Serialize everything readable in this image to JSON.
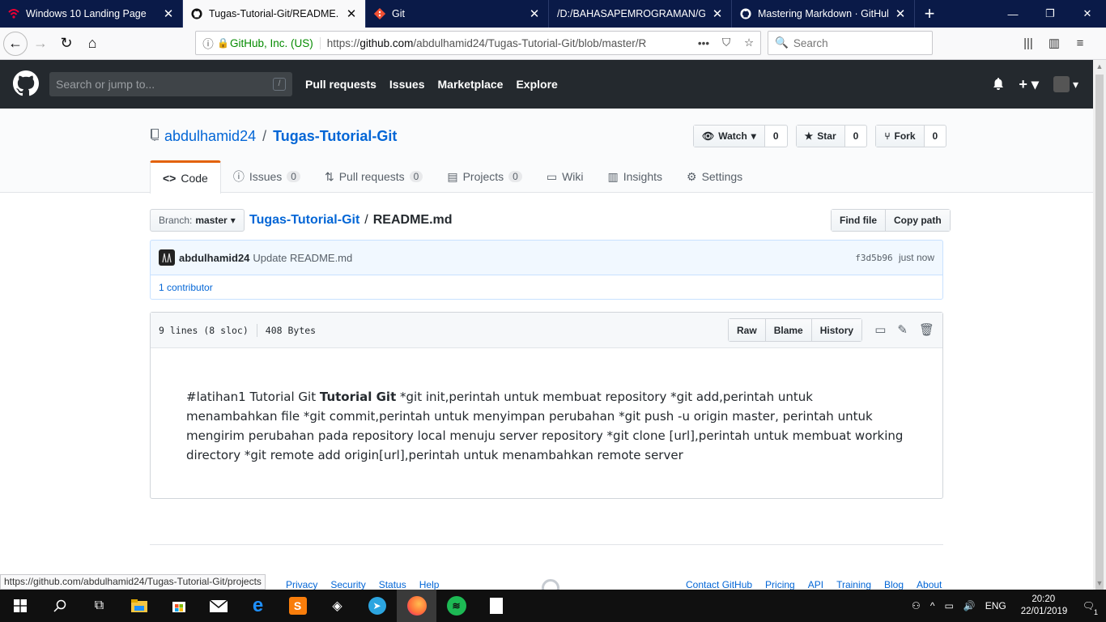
{
  "browser": {
    "tabs": [
      {
        "title": "Windows 10 Landing Page",
        "icon": "wifi-icon",
        "active": false
      },
      {
        "title": "Tugas-Tutorial-Git/README.m",
        "icon": "github-icon",
        "active": true
      },
      {
        "title": "Git",
        "icon": "git-icon",
        "active": false
      },
      {
        "title": "/D:/BAHASAPEMROGRAMAN/Git/",
        "icon": "",
        "active": false
      },
      {
        "title": "Mastering Markdown · GitHub",
        "icon": "github-icon",
        "active": false
      }
    ],
    "identity": "GitHub, Inc. (US)",
    "url_prefix": "https://",
    "url_host": "github.com",
    "url_path": "/abdulhamid24/Tugas-Tutorial-Git/blob/master/R",
    "search_placeholder": "Search"
  },
  "gh": {
    "search_placeholder": "Search or jump to...",
    "search_key": "/",
    "nav": [
      "Pull requests",
      "Issues",
      "Marketplace",
      "Explore"
    ]
  },
  "repo": {
    "owner": "abdulhamid24",
    "separator": "/",
    "name": "Tugas-Tutorial-Git",
    "watch_label": "Watch",
    "watch_count": "0",
    "star_label": "Star",
    "star_count": "0",
    "fork_label": "Fork",
    "fork_count": "0",
    "tabs": [
      {
        "label": "Code",
        "count": "",
        "icon": "code-icon"
      },
      {
        "label": "Issues",
        "count": "0",
        "icon": "issue-icon"
      },
      {
        "label": "Pull requests",
        "count": "0",
        "icon": "pull-request-icon"
      },
      {
        "label": "Projects",
        "count": "0",
        "icon": "project-icon"
      },
      {
        "label": "Wiki",
        "count": "",
        "icon": "book-icon"
      },
      {
        "label": "Insights",
        "count": "",
        "icon": "graph-icon"
      },
      {
        "label": "Settings",
        "count": "",
        "icon": "gear-icon"
      }
    ]
  },
  "file": {
    "branch_label": "Branch:",
    "branch": "master",
    "crumb_repo": "Tugas-Tutorial-Git",
    "crumb_sep": "/",
    "filename": "README.md",
    "find_file": "Find file",
    "copy_path": "Copy path",
    "commit_author": "abdulhamid24",
    "commit_message": "Update README.md",
    "commit_sha": "f3d5b96",
    "commit_time": "just now",
    "contributors": "1 contributor",
    "lines": "9 lines (8 sloc)",
    "size": "408 Bytes",
    "raw": "Raw",
    "blame": "Blame",
    "history": "History",
    "content_before": "#latihan1 Tutorial Git ",
    "content_bold": "Tutorial Git",
    "content_after": " *git init,perintah untuk membuat repository *git add,perintah untuk menambahkan file *git commit,perintah untuk menyimpan perubahan *git push -u origin master, perintah untuk mengirim perubahan pada repository local menuju server repository *git clone [url],perintah untuk membuat working directory *git remote add origin[url],perintah untuk menambahkan remote server"
  },
  "footer": {
    "left": [
      "Privacy",
      "Security",
      "Status",
      "Help"
    ],
    "right": [
      "Contact GitHub",
      "Pricing",
      "API",
      "Training",
      "Blog",
      "About"
    ]
  },
  "status_url": "https://github.com/abdulhamid24/Tugas-Tutorial-Git/projects",
  "taskbar": {
    "language": "ENG",
    "time": "20:20",
    "date": "22/01/2019",
    "notification_count": "1"
  }
}
